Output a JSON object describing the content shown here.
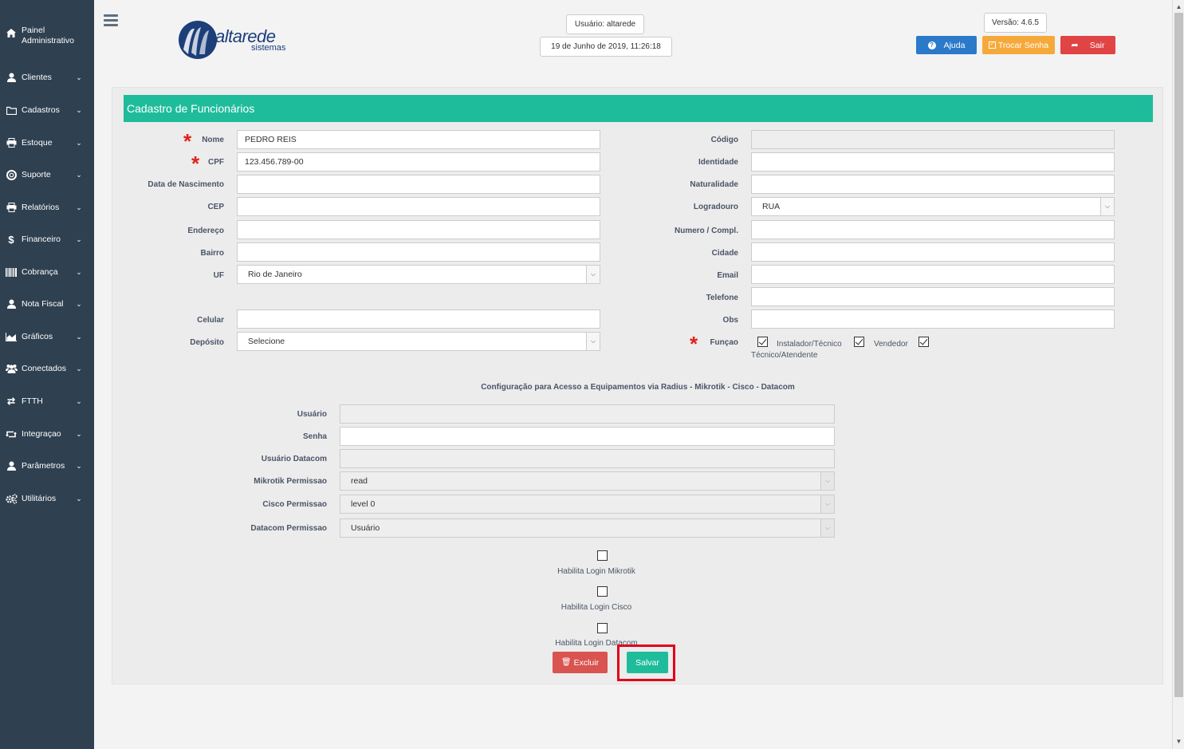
{
  "sidebar": {
    "header": {
      "icon": "home-icon",
      "label": "Painel Administrativo"
    },
    "items": [
      {
        "icon": "user-icon",
        "label": "Clientes"
      },
      {
        "icon": "folder-icon",
        "label": "Cadastros"
      },
      {
        "icon": "print-icon",
        "label": "Estoque"
      },
      {
        "icon": "lifebuoy-icon",
        "label": "Suporte"
      },
      {
        "icon": "print-icon",
        "label": "Relatórios"
      },
      {
        "icon": "dollar-icon",
        "label": "Financeiro"
      },
      {
        "icon": "barcode-icon",
        "label": "Cobrança"
      },
      {
        "icon": "user-icon",
        "label": "Nota Fiscal"
      },
      {
        "icon": "area-chart-icon",
        "label": "Gráficos"
      },
      {
        "icon": "users-icon",
        "label": "Conectados"
      },
      {
        "icon": "random-icon",
        "label": "FTTH"
      },
      {
        "icon": "retweet-icon",
        "label": "Integraçao"
      },
      {
        "icon": "user-icon",
        "label": "Parâmetros"
      },
      {
        "icon": "cogs-icon",
        "label": "Utilitários"
      }
    ]
  },
  "header": {
    "logo_text": "altarede",
    "logo_sub": "sistemas",
    "user": "Usuário: altarede",
    "datetime": "19 de Junho de 2019, 11:26:18",
    "version": "Versão: 4.6.5",
    "help": "Ajuda",
    "change_password": "Trocar Senha",
    "logout": "Sair",
    "colors": {
      "help": "#2a7ac9",
      "change_password": "#f6a93b",
      "logout": "#e04444"
    }
  },
  "form": {
    "title": "Cadastro de Funcionários",
    "left": {
      "nome_label": "Nome",
      "nome_value": "PEDRO REIS",
      "cpf_label": "CPF",
      "cpf_value": "123.456.789-00",
      "nascimento_label": "Data de Nascimento",
      "nascimento_value": "",
      "cep_label": "CEP",
      "cep_value": "",
      "endereco_label": "Endereço",
      "endereco_value": "",
      "bairro_label": "Bairro",
      "bairro_value": "",
      "uf_label": "UF",
      "uf_value": "Rio de Janeiro",
      "celular_label": "Celular",
      "celular_value": "",
      "deposito_label": "Depósito",
      "deposito_value": "Selecione"
    },
    "right": {
      "codigo_label": "Código",
      "codigo_value": "",
      "identidade_label": "Identidade",
      "identidade_value": "",
      "naturalidade_label": "Naturalidade",
      "naturalidade_value": "",
      "logradouro_label": "Logradouro",
      "logradouro_value": "RUA",
      "numero_label": "Numero / Compl.",
      "numero_value": "",
      "cidade_label": "Cidade",
      "cidade_value": "",
      "email_label": "Email",
      "email_value": "",
      "telefone_label": "Telefone",
      "telefone_value": "",
      "obs_label": "Obs",
      "obs_value": "",
      "funcao_label": "Funçao",
      "funcoes": [
        "Instalador/Técnico",
        "Vendedor",
        "Técnico/Atendente"
      ]
    },
    "radius": {
      "section_title": "Configuração para Acesso a Equipamentos via Radius - Mikrotik - Cisco - Datacom",
      "usuario_label": "Usuário",
      "usuario_value": "",
      "senha_label": "Senha",
      "senha_value": "",
      "usuario_datacom_label": "Usuário Datacom",
      "usuario_datacom_value": "",
      "mikrotik_label": "Mikrotik Permissao",
      "mikrotik_value": "read",
      "cisco_label": "Cisco Permissao",
      "cisco_value": "level 0",
      "datacom_label": "Datacom Permissao",
      "datacom_value": "Usuário",
      "hab_mikrotik": "Habilita Login Mikrotik",
      "hab_cisco": "Habilita Login Cisco",
      "hab_datacom": "Habilita Login Datacom"
    },
    "buttons": {
      "delete": "Excluir",
      "save": "Salvar",
      "colors": {
        "delete": "#d9534f",
        "save": "#1fbc9c",
        "highlight": "#e0001b"
      }
    }
  }
}
